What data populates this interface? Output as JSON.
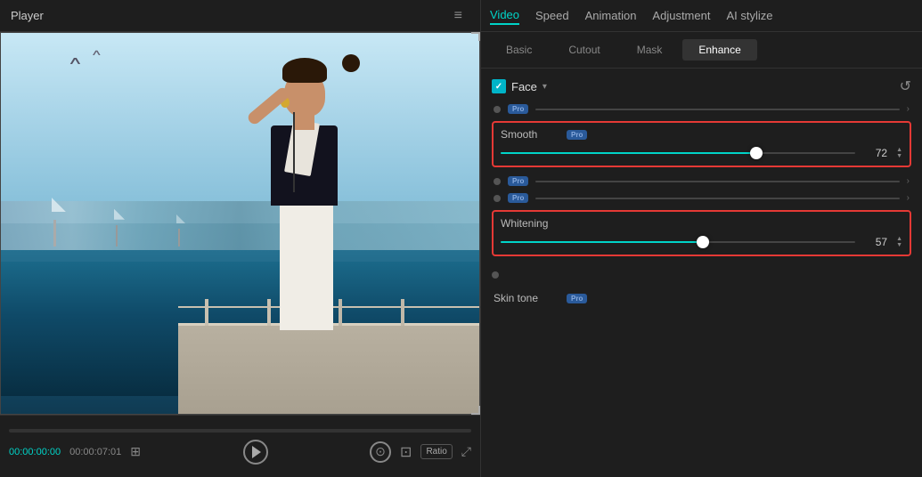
{
  "app": {
    "player_title": "Player",
    "menu_icon": "≡"
  },
  "top_tabs": {
    "items": [
      {
        "label": "Video",
        "active": true
      },
      {
        "label": "Speed",
        "active": false
      },
      {
        "label": "Animation",
        "active": false
      },
      {
        "label": "Adjustment",
        "active": false
      },
      {
        "label": "AI stylize",
        "active": false
      }
    ]
  },
  "sub_tabs": {
    "items": [
      {
        "label": "Basic",
        "active": false
      },
      {
        "label": "Cutout",
        "active": false
      },
      {
        "label": "Mask",
        "active": false
      },
      {
        "label": "Enhance",
        "active": true
      }
    ]
  },
  "face_section": {
    "label": "Face",
    "arrow": "▾",
    "reset_icon": "↺",
    "checkbox_checked": true
  },
  "sliders": {
    "smooth": {
      "label": "Smooth",
      "pro": true,
      "pro_text": "Pro",
      "value": 72,
      "percent": 72,
      "highlighted": true
    },
    "whitening": {
      "label": "Whitening",
      "pro": false,
      "value": 57,
      "percent": 57,
      "highlighted": true
    },
    "skin_tone": {
      "label": "Skin tone",
      "pro": true,
      "pro_text": "Pro"
    }
  },
  "pro_rows": [
    {
      "has_badge": true,
      "pro_text": "Pro"
    },
    {
      "has_badge": true,
      "pro_text": "Pro"
    },
    {
      "has_badge": true,
      "pro_text": "Pro"
    }
  ],
  "controls": {
    "time_current": "00:00:00:00",
    "time_total": "00:00:07:01",
    "ratio_label": "Ratio",
    "capture_icon": "⊙"
  }
}
